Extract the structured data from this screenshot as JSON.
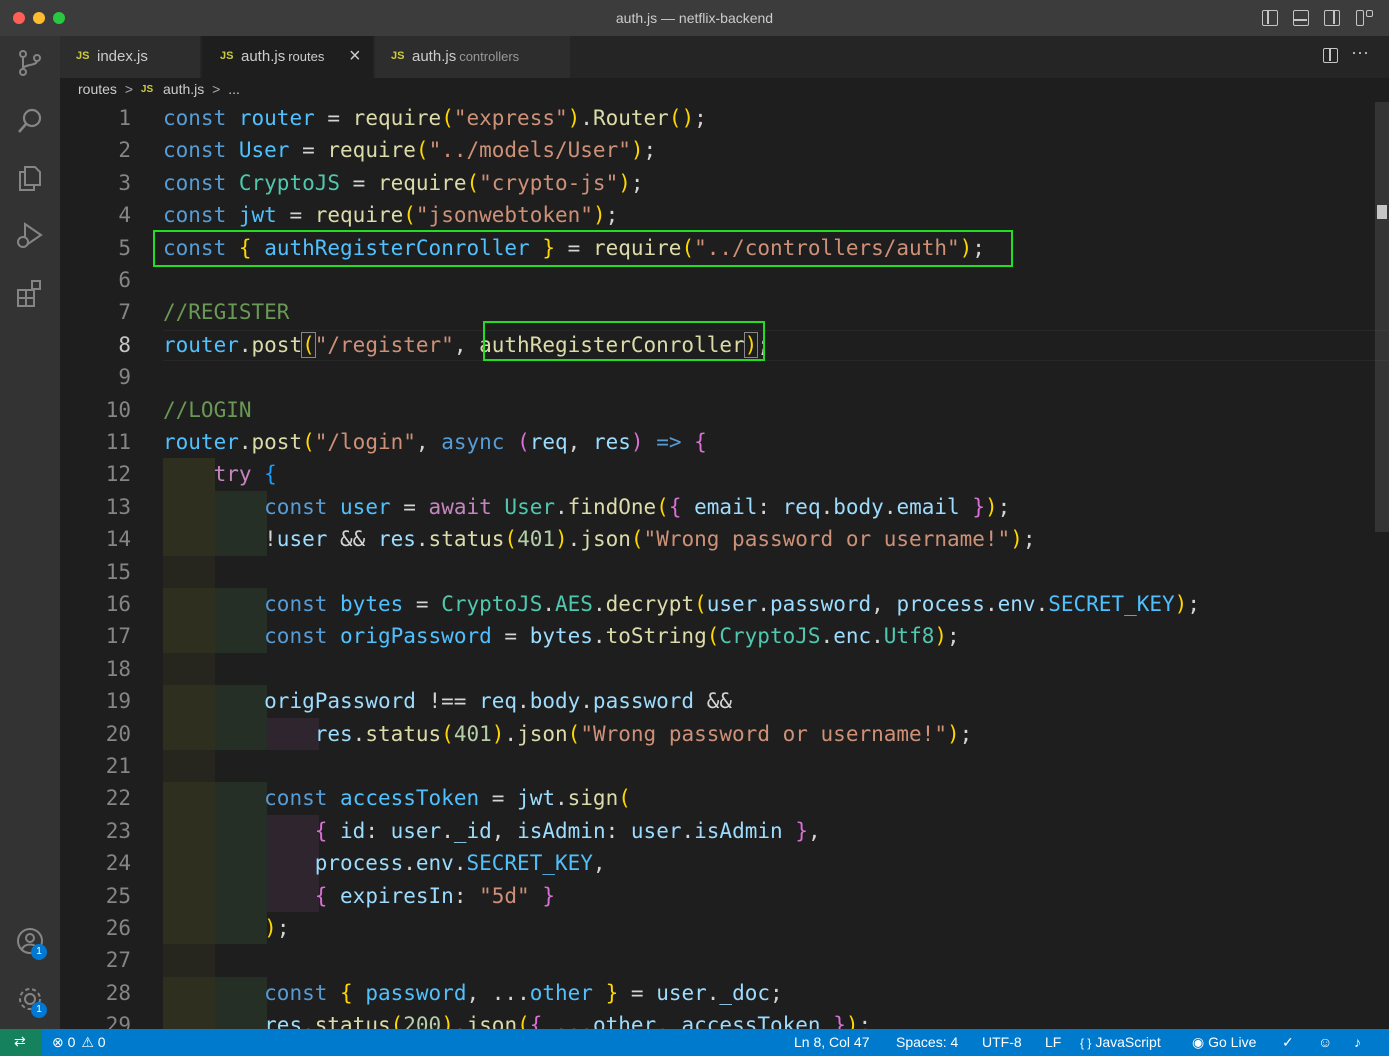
{
  "window": {
    "title": "auth.js — netflix-backend"
  },
  "tabs": [
    {
      "label": "index.js",
      "desc": "",
      "icon": "JS"
    },
    {
      "label": "auth.js",
      "desc": "routes",
      "icon": "JS",
      "active": true,
      "close": "×"
    },
    {
      "label": "auth.js",
      "desc": "controllers",
      "icon": "JS"
    }
  ],
  "breadcrumb": {
    "folder": "routes",
    "sep": ">",
    "icon": "JS",
    "file": "auth.js",
    "more": "..."
  },
  "editor": {
    "line_numbers": [
      "1",
      "2",
      "3",
      "4",
      "5",
      "6",
      "7",
      "8",
      "9",
      "10",
      "11",
      "12",
      "13",
      "14",
      "15",
      "16",
      "17",
      "18",
      "19",
      "20",
      "21",
      "22",
      "23",
      "24",
      "25",
      "26",
      "27",
      "28",
      "29"
    ],
    "current_line": 8
  },
  "activity_badges": {
    "accounts": "1",
    "settings": "1"
  },
  "status": {
    "errors": "0",
    "warnings": "0",
    "position": "Ln 8, Col 47",
    "spaces": "Spaces: 4",
    "encoding": "UTF-8",
    "eol": "LF",
    "language_icon": "{ }",
    "language": "JavaScript",
    "golive": "Go Live"
  },
  "colors": {
    "statusbar": "#007acc",
    "remote": "#16825d",
    "highlight_box": "#22dd22",
    "titlebar": "#3c3c3c"
  }
}
